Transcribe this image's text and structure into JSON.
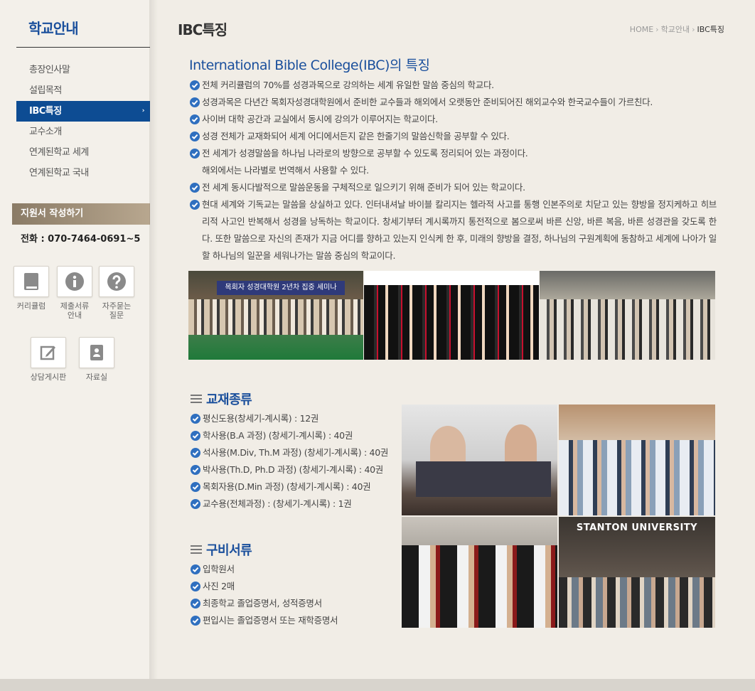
{
  "sidebar": {
    "title": "학교안내",
    "menu": [
      {
        "label": "총장인사말"
      },
      {
        "label": "설립목적"
      },
      {
        "label": "IBC특징",
        "active": true
      },
      {
        "label": "교수소개"
      },
      {
        "label": "연계된학교 세계"
      },
      {
        "label": "연계된학교 국내"
      }
    ],
    "active_arrow": "›",
    "apply_label": "지원서 작성하기",
    "phone": "전화 : 070-7464-0691~5",
    "quick_links": [
      {
        "label_lines": [
          "커리큘럼"
        ],
        "icon": "book-icon"
      },
      {
        "label_lines": [
          "제출서류",
          "안내"
        ],
        "icon": "info-icon"
      },
      {
        "label_lines": [
          "자주묻는",
          "질문"
        ],
        "icon": "question-icon"
      },
      {
        "label_lines": [
          "상담게시판"
        ],
        "icon": "edit-icon"
      },
      {
        "label_lines": [
          "자료실"
        ],
        "icon": "contact-book-icon"
      }
    ]
  },
  "header": {
    "title": "IBC특징",
    "breadcrumb": [
      "HOME",
      "학교안내",
      "IBC특징"
    ]
  },
  "content": {
    "heading": "International Bible College(IBC)의 특징",
    "features": [
      {
        "text": "전체 커리큘럼의 70%를 성경과목으로 강의하는 세계 유일한 말씀 중심의 학교다."
      },
      {
        "text": "성경과목은 다년간 목회자성경대학원에서 준비한 교수들과 해외에서 오랫동안 준비되어진 해외교수와 한국교수들이 가르친다."
      },
      {
        "text": "사이버 대학 공간과 교실에서 동시에 강의가 이루어지는 학교이다."
      },
      {
        "text": "성경 전체가 교재화되어 세계 어디에서든지 같은 한줄기의 말씀신학을 공부할 수 있다."
      },
      {
        "text": "전 세계가 성경말씀을 하나님 나라로의 방향으로 공부할 수 있도록 정리되어 있는 과정이다.",
        "continuation": "해외에서는 나라별로 번역해서 사용할 수 있다."
      },
      {
        "text": "전 세계 동시다발적으로 말씀운동을 구체적으로 일으키기 위해 준비가 되어 있는 학교이다."
      },
      {
        "text": "현대 세계와 기독교는 말씀을 상실하고 있다. 인터내셔날 바이블 칼리지는 헬라적 사고를 통행 인본주의로 치닫고 있는 향방을 정지케하고 히브리적 사고인 반복해서 성경을 낭독하는 학교이다. 창세기부터 계시록까지 통전적으로 봄으로써 바른 신앙, 바른 복음, 바른 성경관을 갖도록 한다. 또한 말씀으로 자신의 존재가 지금 어디를 향하고 있는지 인식케 한 후, 미래의 향방을 결정, 하나님의 구원계획에 동참하고 세계에 나아가 일할 하나님의 일꾼을 세워나가는 말씀 중심의 학교이다."
      }
    ],
    "photo_banner_text": "목회자 성경대학원 2년차 집중 세미나",
    "textbooks_heading": "교재종류",
    "textbooks": [
      "평신도용(창세기-계시록) : 12권",
      "학사용(B.A 과정) (창세기-계시록) : 40권",
      "석사용(M.Div, Th.M 과정) (창세기-계시록) : 40권",
      "박사용(Th.D, Ph.D 과정) (창세기-계시록) : 40권",
      "목회자용(D.Min 과정) (창세기-계시록) : 40권",
      "교수용(전체과정) : (창세기-계시록) : 1권"
    ],
    "documents_heading": "구비서류",
    "documents": [
      "입학원서",
      "사진 2매",
      "최종학교 졸업증명서, 성적증명서",
      "편입시는 졸업증명서 또는 재학증명서"
    ],
    "stanton_sign": "STANTON UNIVERSITY"
  },
  "colors": {
    "accent": "#1a4f9c",
    "active_menu": "#0d4c93",
    "check": "#2f6fbf"
  }
}
